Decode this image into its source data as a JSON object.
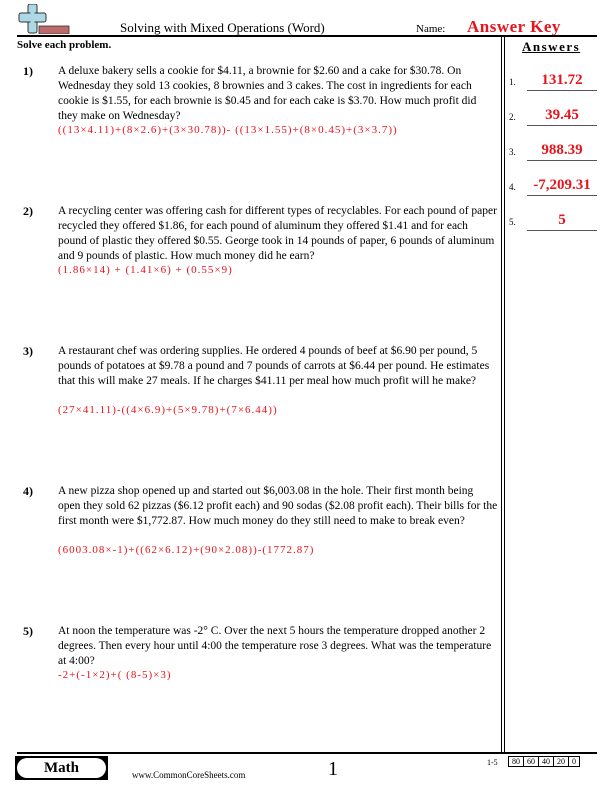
{
  "header": {
    "title": "Solving with Mixed Operations (Word)",
    "name_label": "Name:",
    "answer_key": "Answer Key",
    "instructions": "Solve each problem."
  },
  "answers": {
    "heading": "Answers",
    "items": [
      {
        "num": "1.",
        "value": "131.72"
      },
      {
        "num": "2.",
        "value": "39.45"
      },
      {
        "num": "3.",
        "value": "988.39"
      },
      {
        "num": "4.",
        "value": "-7,209.31"
      },
      {
        "num": "5.",
        "value": "5"
      }
    ]
  },
  "problems": [
    {
      "num": "1)",
      "text": "A deluxe bakery sells a cookie for $4.11, a brownie for $2.60 and a cake for $30.78. On Wednesday they sold 13 cookies, 8 brownies and 3 cakes. The cost in ingredients for each cookie is $1.55, for each brownie is $0.45 and for each cake is $3.70. How much profit did they make on Wednesday?",
      "work": "((13×4.11)+(8×2.6)+(3×30.78))-  ((13×1.55)+(8×0.45)+(3×3.7))"
    },
    {
      "num": "2)",
      "text": "A recycling center was offering cash for different types of recyclables. For each pound of paper recycled they offered $1.86, for each pound of aluminum they offered $1.41 and for each pound of plastic they offered $0.55. George took in 14 pounds of paper, 6 pounds of aluminum and 9 pounds of plastic. How much money did he earn?",
      "work": "(1.86×14)  +  (1.41×6)  +  (0.55×9)"
    },
    {
      "num": "3)",
      "text": "A restaurant chef was ordering supplies. He ordered 4 pounds of beef at $6.90 per pound, 5 pounds of potatoes at $9.78 a pound and 7 pounds of carrots at $6.44 per pound. He estimates that this will make 27 meals. If he charges $41.11 per meal how much profit will he make?",
      "work": "(27×41.11)-((4×6.9)+(5×9.78)+(7×6.44))"
    },
    {
      "num": "4)",
      "text": "A new pizza shop opened up and started out $6,003.08 in the hole. Their first month being open they sold 62 pizzas ($6.12 profit each) and 90 sodas ($2.08 profit each). Their bills for the first month were $1,772.87. How much money do they still need to make to break even?",
      "work": "(6003.08×-1)+((62×6.12)+(90×2.08))-(1772.87)"
    },
    {
      "num": "5)",
      "text": "At noon the temperature was -2° C. Over the next 5 hours the temperature dropped another 2 degrees. Then every hour until 4:00 the temperature rose 3 degrees. What was the temperature at 4:00?",
      "work": "-2+(-1×2)+(  (8-5)×3)"
    }
  ],
  "footer": {
    "subject": "Math",
    "website": "www.CommonCoreSheets.com",
    "page": "1",
    "score_range": "1-5",
    "scores": [
      "80",
      "60",
      "40",
      "20",
      "0"
    ]
  },
  "colors": {
    "answer_red": "#e8141c",
    "logo_blue": "#add8e6",
    "logo_red": "#bc6a6a"
  }
}
